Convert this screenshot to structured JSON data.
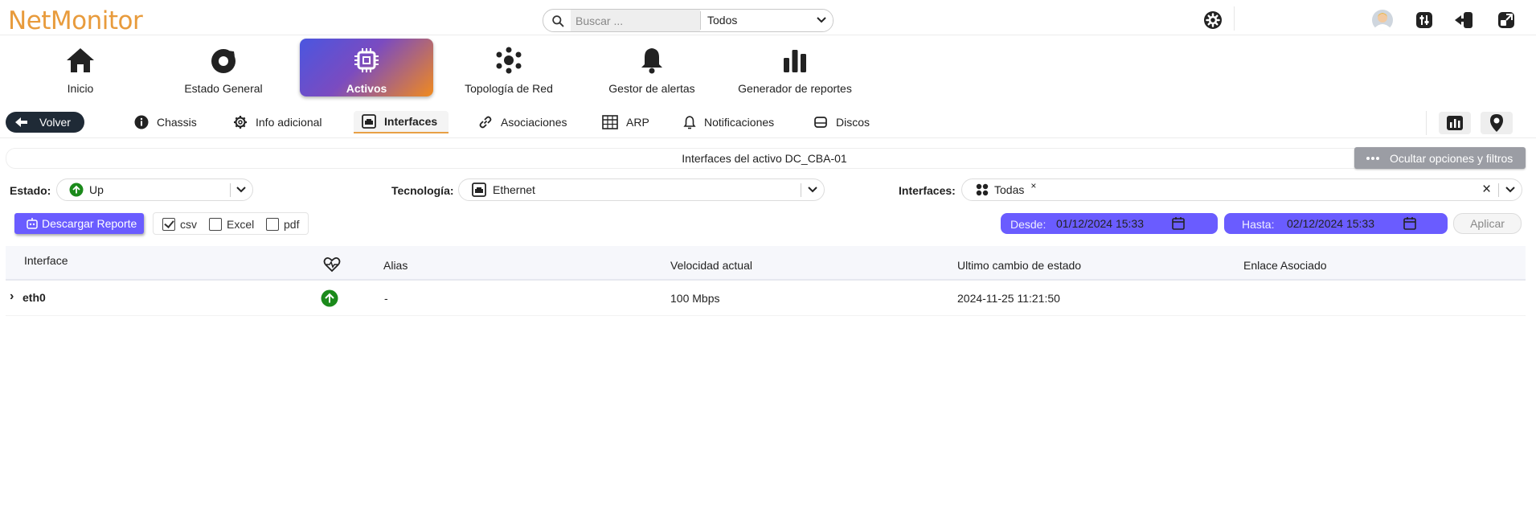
{
  "app": {
    "logo": "NetMonitor"
  },
  "search": {
    "placeholder": "Buscar ...",
    "scope": "Todos"
  },
  "nav": {
    "items": [
      {
        "label": "Inicio",
        "icon": "home-icon"
      },
      {
        "label": "Estado General",
        "icon": "status-icon"
      },
      {
        "label": "Activos",
        "icon": "chip-icon",
        "active": true
      },
      {
        "label": "Topología de Red",
        "icon": "topology-icon"
      },
      {
        "label": "Gestor de alertas",
        "icon": "bell-icon"
      },
      {
        "label": "Generador de reportes",
        "icon": "bar-chart-icon"
      }
    ]
  },
  "subnav": {
    "back": "Volver",
    "tabs": [
      {
        "label": "Chassis",
        "icon": "info-icon"
      },
      {
        "label": "Info adicional",
        "icon": "gear-icon"
      },
      {
        "label": "Interfaces",
        "icon": "ethernet-icon",
        "active": true
      },
      {
        "label": "Asociaciones",
        "icon": "link-icon"
      },
      {
        "label": "ARP",
        "icon": "table-icon"
      },
      {
        "label": "Notificaciones",
        "icon": "bell-icon"
      },
      {
        "label": "Discos",
        "icon": "disk-icon"
      }
    ]
  },
  "panel": {
    "title": "Interfaces del activo DC_CBA-01",
    "hide_options": "Ocultar opciones y filtros"
  },
  "filters": {
    "estado_label": "Estado:",
    "estado_value": "Up",
    "tecnologia_label": "Tecnología:",
    "tecnologia_value": "Ethernet",
    "interfaces_label": "Interfaces:",
    "interfaces_chip": "Todas",
    "chip_remove": "×",
    "clear": "×"
  },
  "report": {
    "download": "Descargar Reporte",
    "formats": [
      {
        "label": "csv",
        "checked": true
      },
      {
        "label": "Excel",
        "checked": false
      },
      {
        "label": "pdf",
        "checked": false
      }
    ],
    "desde_label": "Desde:",
    "desde_value": "01/12/2024  15:33",
    "hasta_label": "Hasta:",
    "hasta_value": "02/12/2024  15:33",
    "apply": "Aplicar"
  },
  "table": {
    "columns": [
      "Interface",
      "",
      "Alias",
      "Velocidad actual",
      "Ultimo cambio de estado",
      "Enlace Asociado"
    ],
    "rows": [
      {
        "expand": "›",
        "interface": "eth0",
        "status": "up",
        "alias": "-",
        "speed": "100 Mbps",
        "last_change": "2024-11-25 11:21:50",
        "link": ""
      }
    ]
  },
  "colors": {
    "accent": "#6a5cff",
    "logo": "#e89b3c",
    "status_up": "#1b8a1b",
    "dark": "#1f2a36"
  }
}
